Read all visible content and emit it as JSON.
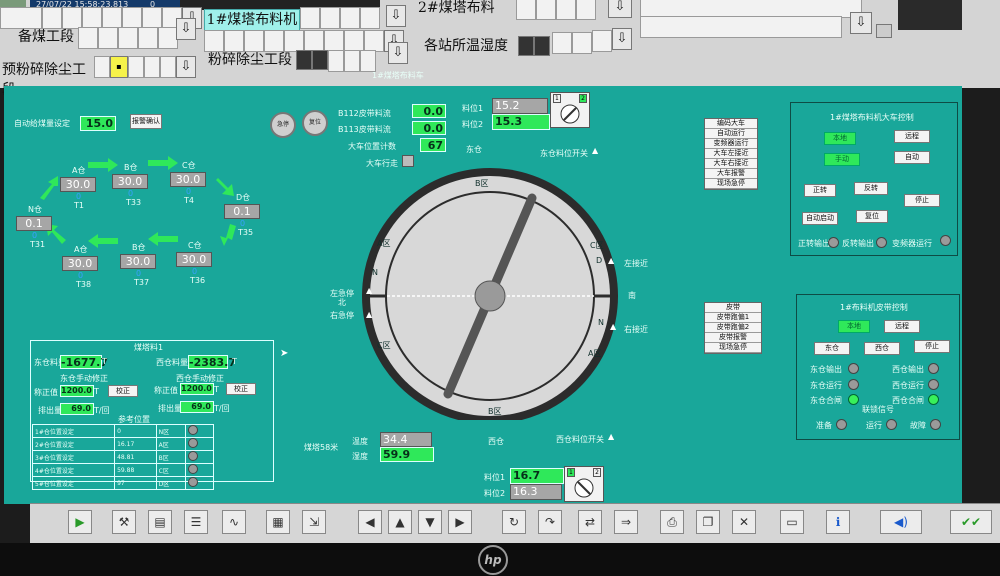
{
  "topbar": {
    "datetime": "27/07/22 15:58:23.813",
    "status_value": "0",
    "tab1_label": "1#煤塔布料机",
    "tab2_label": "2#煤塔布料",
    "row2_left_label": "备煤工段",
    "row2_mid_label": "粉碎除尘工段",
    "row2_right_label": "各站所温湿度",
    "row3_left_label": "预粉碎除尘工段"
  },
  "hmi": {
    "header_title": "1#煤塔布料车",
    "flow_label": "自动给煤量设定",
    "flow_value": "15.0",
    "flow_button": "报警确认",
    "stop_label": "急停",
    "reset_label": "复位",
    "belt1_label": "B112皮带料流",
    "belt1_value": "0.0",
    "belt2_label": "B113皮带料流",
    "belt2_value": "0.0",
    "cart_pos_label": "大车位置计数",
    "cart_pos_value": "67",
    "cart_walk_label": "大车行走",
    "level1_label": "料位1",
    "level1_value": "15.2",
    "level2_label": "料位2",
    "level2_value": "15.3",
    "switch_top_1": "1",
    "switch_top_2": "2",
    "east_label": "东仓",
    "east_limit_label": "东仓料位开关",
    "west_label": "西仓",
    "west_limit_label": "西仓料位开关",
    "temp_label": "温度",
    "temp_value": "34.4",
    "humid_label": "湿度",
    "humid_value": "59.9",
    "tower_label": "煤塔58米",
    "bottom_level1_label": "料位1",
    "bottom_level1_value": "16.7",
    "bottom_level2_label": "料位2",
    "bottom_level2_value": "16.3",
    "switch_bot_1": "1",
    "switch_bot_2": "2"
  },
  "dial": {
    "zone_b_top": "B区",
    "zone_a_left": "A区",
    "zone_c_right": "C区",
    "zone_c_left": "C区",
    "zone_a_right": "A区",
    "zone_b_bottom": "B区",
    "n_left": "N",
    "n_right": "N",
    "d_right": "D",
    "north_stop_label": "左急停",
    "north_label": "北",
    "right_stop_label": "右急停",
    "south_label": "南",
    "left_near_label": "左接近",
    "right_near_label": "右接近"
  },
  "silos": [
    {
      "name": "A仓",
      "value": "30.0",
      "sub": "T1"
    },
    {
      "name": "B仓",
      "value": "30.0",
      "sub": "T33"
    },
    {
      "name": "C仓",
      "value": "30.0",
      "sub": "T4"
    },
    {
      "name": "D仓",
      "value": "0.1",
      "sub": "T35"
    },
    {
      "name": "N仓",
      "value": "0.1",
      "sub": "T31"
    },
    {
      "name": "A仓",
      "value": "30.0",
      "sub": "T38"
    },
    {
      "name": "B仓",
      "value": "30.0",
      "sub": "T37"
    },
    {
      "name": "C仓",
      "value": "30.0",
      "sub": "T36"
    }
  ],
  "silo_zero": "0",
  "left_table": {
    "title": "煤塔料1",
    "east_weight_label": "东仓料量",
    "east_weight_value": "-1677.7",
    "west_weight_label": "西仓料量",
    "west_weight_value": "-2383.7",
    "unit_t": "T",
    "east_correct_label": "东仓手动修正",
    "west_correct_label": "西仓手动修正",
    "correct_label": "称正值",
    "east_correct_value": "1200.0",
    "west_correct_value": "1200.0",
    "correct_button": "校正",
    "discharge_label": "排出量",
    "east_discharge_value": "69.0",
    "west_discharge_value": "69.0",
    "discharge_unit": "T/回",
    "sub_title": "参考位置",
    "ref_rows": [
      {
        "a": "1#仓位置设定",
        "b": "0",
        "c": "N区"
      },
      {
        "a": "2#仓位置设定",
        "b": "16.17",
        "c": "A区"
      },
      {
        "a": "3#仓位置设定",
        "b": "48.81",
        "c": "B区"
      },
      {
        "a": "4#仓位置设定",
        "b": "59.88",
        "c": "C区"
      },
      {
        "a": "5#仓位置设定",
        "b": "97",
        "c": "D区"
      }
    ]
  },
  "right_panel1": {
    "title": "1#煤塔布料机大车控制",
    "local": "本地",
    "remote": "远程",
    "manual": "手动",
    "auto": "自动",
    "forward": "正转",
    "reverse": "反转",
    "stop": "停止",
    "auto_start": "自动启动",
    "reset": "复位",
    "fwd_out": "正转输出",
    "rev_out": "反转输出",
    "inverter_run": "变频器运行"
  },
  "menu1": {
    "title": "编码大车",
    "items": [
      "自动运行",
      "变频器运行",
      "大车左接近",
      "大车右接近",
      "大车报警",
      "现场急停"
    ]
  },
  "menu2": {
    "title": "皮带",
    "items": [
      "皮带跑偏1",
      "皮带跑偏2",
      "皮带报警",
      "现场急停"
    ]
  },
  "right_panel2": {
    "title": "1#布料机皮带控制",
    "local": "本地",
    "remote": "远程",
    "east": "东仓",
    "west": "西仓",
    "stop": "停止",
    "east_out": "东仓输出",
    "west_out": "西仓输出",
    "east_run": "东仓运行",
    "west_run": "西仓运行",
    "east_gate": "东仓合闸",
    "west_gate": "西仓合闸",
    "interlock": "联锁信号",
    "ready": "准备",
    "running": "运行",
    "fault": "故障"
  }
}
